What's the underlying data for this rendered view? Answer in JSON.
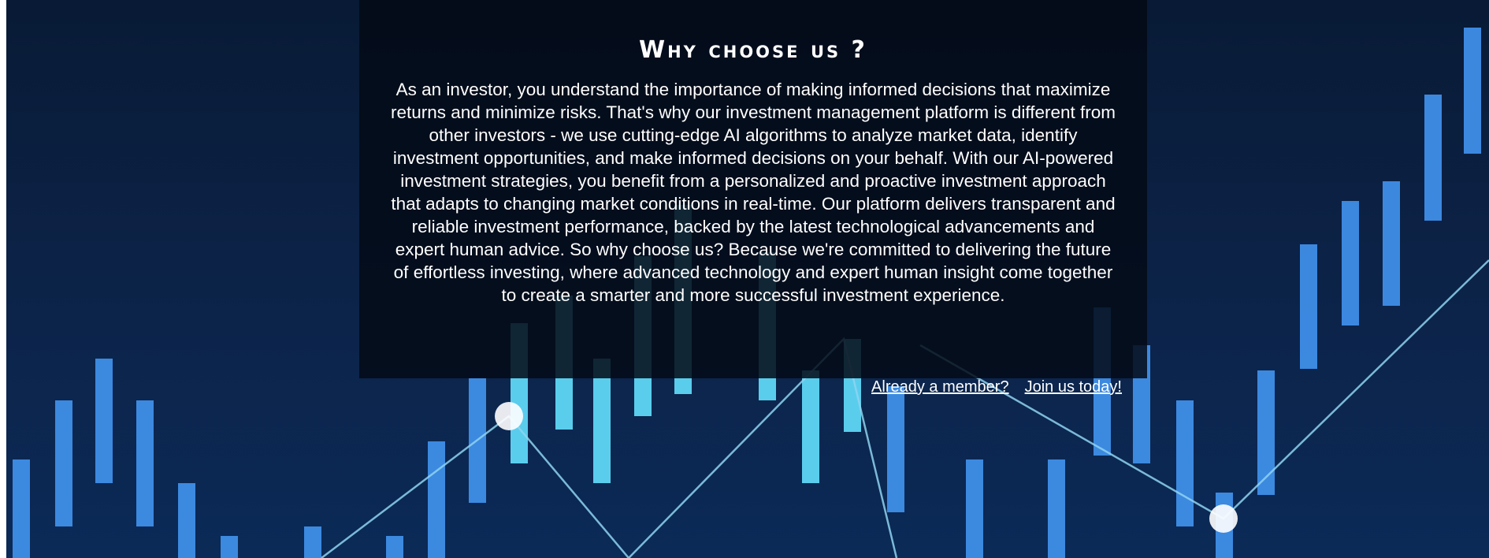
{
  "hero": {
    "background": "stock-candlestick-chart-image",
    "colors": {
      "bar": "#3f8ee8",
      "bar_light": "#5fd6f6",
      "line": "#8fd3f0",
      "panel": "#040a16"
    }
  },
  "section": {
    "title": "Why choose us ?",
    "body": "As an investor, you understand the importance of making informed decisions that maximize returns and minimize risks. That's why our investment management platform is different from other investors - we use cutting-edge AI algorithms to analyze market data, identify investment opportunities, and make informed decisions on your behalf. With our AI-powered investment strategies, you benefit from a personalized and proactive investment approach that adapts to changing market conditions in real-time. Our platform delivers transparent and reliable investment performance, backed by the latest technological advancements and expert human advice. So why choose us? Because we're committed to delivering the future of effortless investing, where advanced technology and expert human insight come together to create a smarter and more successful investment experience."
  },
  "links": {
    "login": "Already a member?",
    "signup": "Join us today!"
  }
}
